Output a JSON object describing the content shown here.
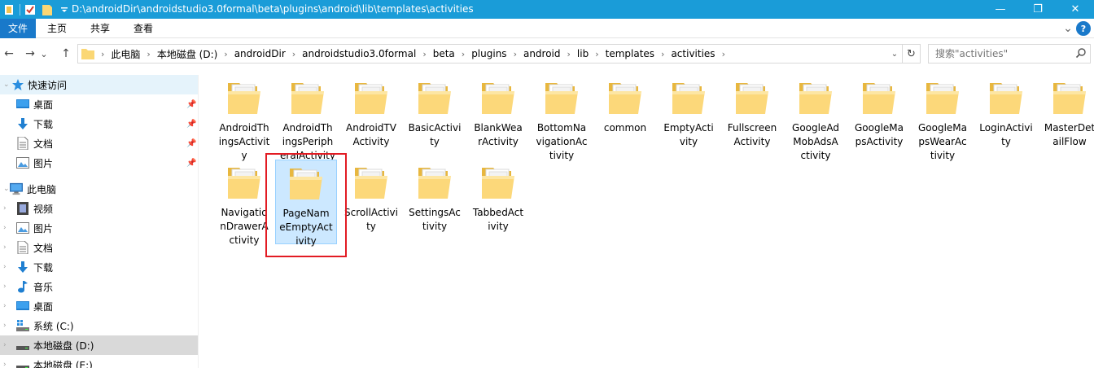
{
  "titlebar": {
    "title": "D:\\androidDir\\androidstudio3.0formal\\beta\\plugins\\android\\lib\\templates\\activities",
    "minimize": "—",
    "restore": "❐",
    "close": "✕",
    "color": "#1a9cd8"
  },
  "ribbon": {
    "tabs": [
      "文件",
      "主页",
      "共享",
      "查看"
    ],
    "expand": "⌄",
    "help": "?"
  },
  "nav": {
    "back": "←",
    "forward": "→",
    "recent": "⌄",
    "up": "↑",
    "breadcrumbs": [
      "此电脑",
      "本地磁盘 (D:)",
      "androidDir",
      "androidstudio3.0formal",
      "beta",
      "plugins",
      "android",
      "lib",
      "templates",
      "activities"
    ],
    "refresh": "↻",
    "search_placeholder": "搜索\"activities\""
  },
  "sidebar": {
    "items": [
      {
        "label": "快速访问",
        "icon": "star-icon"
      },
      {
        "label": "桌面",
        "icon": "desktop-icon",
        "pinned": true
      },
      {
        "label": "下载",
        "icon": "download-icon",
        "pinned": true
      },
      {
        "label": "文档",
        "icon": "document-icon",
        "pinned": true
      },
      {
        "label": "图片",
        "icon": "pictures-icon",
        "pinned": true
      },
      {
        "label": "此电脑",
        "icon": "computer-icon"
      },
      {
        "label": "视频",
        "icon": "video-icon"
      },
      {
        "label": "图片",
        "icon": "pictures-icon"
      },
      {
        "label": "文档",
        "icon": "document-icon"
      },
      {
        "label": "下载",
        "icon": "download-icon"
      },
      {
        "label": "音乐",
        "icon": "music-icon"
      },
      {
        "label": "桌面",
        "icon": "desktop-icon"
      },
      {
        "label": "系统 (C:)",
        "icon": "system-drive-icon"
      },
      {
        "label": "本地磁盘 (D:)",
        "icon": "drive-icon",
        "selected": true
      },
      {
        "label": "本地磁盘 (E:)",
        "icon": "drive-icon"
      }
    ]
  },
  "folders": [
    {
      "name": "AndroidThingsActivity",
      "lines": [
        "AndroidTh",
        "ingsActivit",
        "y"
      ]
    },
    {
      "name": "AndroidThingsPeripheralActivity",
      "lines": [
        "AndroidTh",
        "ingsPeriph",
        "eralActivity"
      ]
    },
    {
      "name": "AndroidTVActivity",
      "lines": [
        "AndroidTV",
        "Activity"
      ]
    },
    {
      "name": "BasicActivity",
      "lines": [
        "BasicActivi",
        "ty"
      ]
    },
    {
      "name": "BlankWearActivity",
      "lines": [
        "BlankWea",
        "rActivity"
      ]
    },
    {
      "name": "BottomNavigationActivity",
      "lines": [
        "BottomNa",
        "vigationAc",
        "tivity"
      ]
    },
    {
      "name": "common",
      "lines": [
        "common"
      ]
    },
    {
      "name": "EmptyActivity",
      "lines": [
        "EmptyActi",
        "vity"
      ]
    },
    {
      "name": "FullscreenActivity",
      "lines": [
        "Fullscreen",
        "Activity"
      ]
    },
    {
      "name": "GoogleAdMobAdsActivity",
      "lines": [
        "GoogleAd",
        "MobAdsA",
        "ctivity"
      ]
    },
    {
      "name": "GoogleMapsActivity",
      "lines": [
        "GoogleMa",
        "psActivity"
      ]
    },
    {
      "name": "GoogleMapsWearActivity",
      "lines": [
        "GoogleMa",
        "psWearAc",
        "tivity"
      ]
    },
    {
      "name": "LoginActivity",
      "lines": [
        "LoginActivi",
        "ty"
      ]
    },
    {
      "name": "MasterDetailFlow",
      "lines": [
        "MasterDet",
        "ailFlow"
      ]
    },
    {
      "name": "NavigationDrawerActivity",
      "lines": [
        "Navigatio",
        "nDrawerA",
        "ctivity"
      ]
    },
    {
      "name": "PageNameEmptyActivity",
      "lines": [
        "PageNam",
        "eEmptyAct",
        "ivity"
      ],
      "selected": true
    },
    {
      "name": "ScrollActivity",
      "lines": [
        "ScrollActivi",
        "ty"
      ]
    },
    {
      "name": "SettingsActivity",
      "lines": [
        "SettingsAc",
        "tivity"
      ]
    },
    {
      "name": "TabbedActivity",
      "lines": [
        "TabbedAct",
        "ivity"
      ]
    }
  ]
}
